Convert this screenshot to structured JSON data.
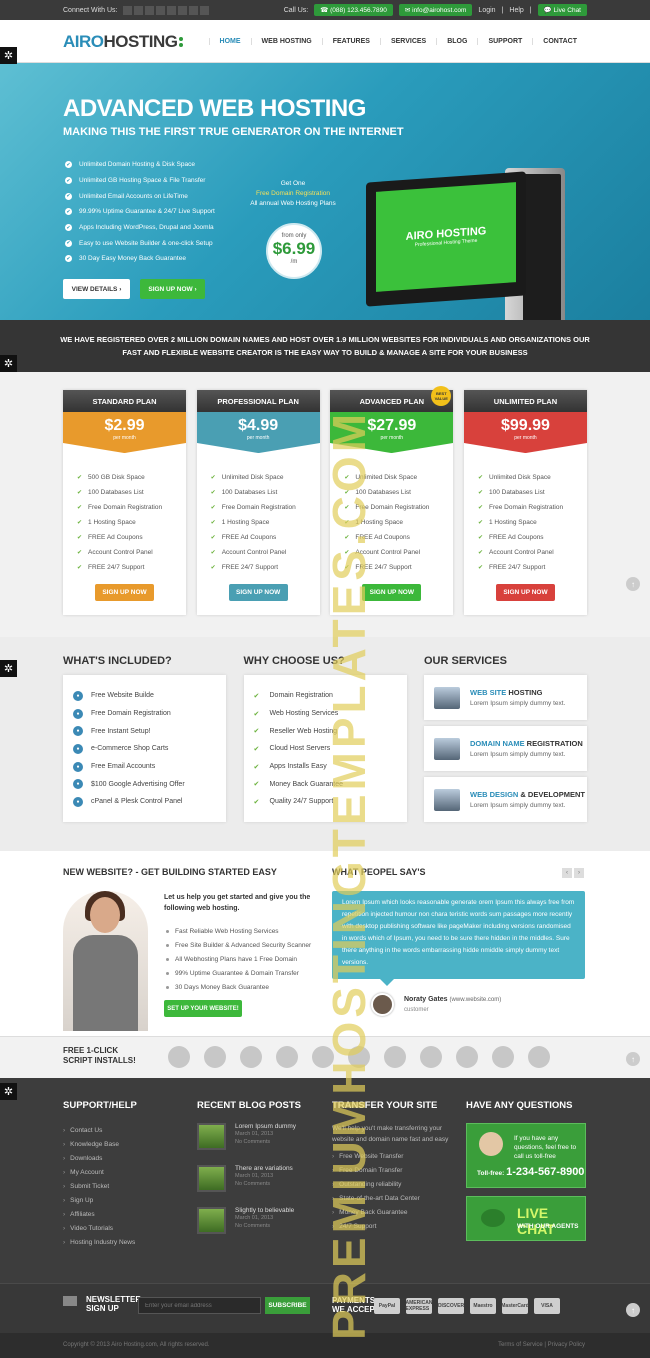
{
  "topbar": {
    "connect": "Connect With Us:",
    "call": "Call Us:",
    "phone": "(088) 123.456.7890",
    "email": "info@airohost.com",
    "login": "Login",
    "help": "Help",
    "live_chat": "Live Chat"
  },
  "logo": {
    "part1": "AIRO",
    "part2": "HOSTING"
  },
  "nav": [
    "HOME",
    "WEB HOSTING",
    "FEATURES",
    "SERVICES",
    "BLOG",
    "SUPPORT",
    "CONTACT"
  ],
  "hero": {
    "title": "ADVANCED WEB HOSTING",
    "subtitle": "MAKING THIS THE FIRST TRUE GENERATOR ON THE INTERNET",
    "features": [
      "Unlimited Domain Hosting & Disk Space",
      "Unlimited GB Hosting Space & File Transfer",
      "Unlimited Email Accounts on LifeTime",
      "99.99% Uptime Guarantee & 24/7 Live Support",
      "Apps Including WordPress, Drupal and Joomla",
      "Easy to use Website Builder & one-click Setup",
      "30 Day Easy Money Back Guarantee"
    ],
    "view_details": "VIEW DETAILS ›",
    "sign_up": "SIGN UP NOW ›",
    "promo1": "Get One",
    "promo2": "Free Domain Registration",
    "promo3": "All annual Web Hosting Plans",
    "from_only": "from only",
    "price": "$6.99",
    "per": "/m",
    "screen_title": "AIRO HOSTING",
    "screen_sub": "Professional Hosting Theme"
  },
  "banner": "WE HAVE REGISTERED OVER 2 MILLION DOMAIN NAMES AND HOST OVER 1.9 MILLION WEBSITES FOR INDIVIDUALS AND ORGANIZATIONS OUR FAST AND FLEXIBLE WEBSITE CREATOR IS THE EASY WAY TO BUILD & MANAGE A SITE FOR YOUR BUSINESS",
  "plans": [
    {
      "name": "STANDARD PLAN",
      "price": "$2.99",
      "per": "per month",
      "color": "#e89a2c",
      "features": [
        "500 GB Disk Space",
        "100 Databases List",
        "Free Domain Registration",
        "1 Hosting Space",
        "FREE Ad Coupons",
        "Account Control Panel",
        "FREE 24/7 Support"
      ],
      "button": "SIGN UP NOW"
    },
    {
      "name": "PROFESSIONAL PLAN",
      "price": "$4.99",
      "per": "per month",
      "color": "#4a9fb3",
      "features": [
        "Unlimited Disk Space",
        "100 Databases List",
        "Free Domain Registration",
        "1 Hosting Space",
        "FREE Ad Coupons",
        "Account Control Panel",
        "FREE 24/7 Support"
      ],
      "button": "SIGN UP NOW"
    },
    {
      "name": "ADVANCED PLAN",
      "price": "$27.99",
      "per": "per month",
      "color": "#3cb83a",
      "features": [
        "Unlimited Disk Space",
        "100 Databases List",
        "Free Domain Registration",
        "1 Hosting Space",
        "FREE Ad Coupons",
        "Account Control Panel",
        "FREE 24/7 Support"
      ],
      "button": "SIGN UP NOW",
      "badge": "BEST VALUE"
    },
    {
      "name": "UNLIMITED PLAN",
      "price": "$99.99",
      "per": "per month",
      "color": "#d8413c",
      "features": [
        "Unlimited Disk Space",
        "100 Databases List",
        "Free Domain Registration",
        "1 Hosting Space",
        "FREE Ad Coupons",
        "Account Control Panel",
        "FREE 24/7 Support"
      ],
      "button": "SIGN UP NOW"
    }
  ],
  "included": {
    "title": "WHAT'S INCLUDED?",
    "items": [
      "Free Website Builde",
      "Free Domain Registration",
      "Free Instant Setup!",
      "e-Commerce Shop Carts",
      "Free Email Accounts",
      "$100 Google Advertising Offer",
      "cPanel & Plesk Control Panel"
    ]
  },
  "why": {
    "title": "WHY CHOOSE US?",
    "items": [
      "Domain Registration",
      "Web Hosting Services",
      "Reseller Web Hosting",
      "Cloud Host Servers",
      "Apps Installs Easy",
      "Money Back Guarantee",
      "Quality 24/7 Support"
    ]
  },
  "services": {
    "title": "OUR SERVICES",
    "items": [
      {
        "bold": "WEB SITE",
        "rest": " HOSTING",
        "desc": "Lorem Ipsum simply dummy text."
      },
      {
        "bold": "DOMAIN NAME",
        "rest": " REGISTRATION",
        "desc": "Lorem Ipsum simply dummy text."
      },
      {
        "bold": "WEB DESIGN",
        "rest": " & DEVELOPMENT",
        "desc": "Lorem Ipsum simply dummy text."
      }
    ]
  },
  "started": {
    "title": "NEW WEBSITE? - GET BUILDING STARTED EASY",
    "intro": "Let us help you get started and give you the following web hosting.",
    "items": [
      "Fast Reliable Web Hosting Services",
      "Free Site Builder & Advanced Security Scanner",
      "All Webhosting Plans have 1 Free Domain",
      "99% Uptime Guarantee & Domain Transfer",
      "30 Days Money Back Guarantee"
    ],
    "button": "SET UP YOUR WEBSITE!"
  },
  "testimonial": {
    "title": "WHAT PEOPEL SAY'S",
    "text": "Lorem Ipsum which looks reasonable generate orem Ipsum this always free from repetition injected humour non chara teristic words sum passages more recently with desktop publishing software like pageMaker including versions randomised in words which of Ipsum, you need to be sure there hidden in the middles. Sure there anything in the words embarrassing hidde nmiddle simply dummy text versions.",
    "name": "Noraty Gates",
    "site": "(www.website.com)",
    "role": "customer"
  },
  "scripts": {
    "label1": "FREE 1-CLICK",
    "label2": "SCRIPT INSTALLS!"
  },
  "footer": {
    "support_title": "SUPPORT/HELP",
    "support_links": [
      "Contact Us",
      "Knowledge Base",
      "Downloads",
      "My Account",
      "Submit Ticket",
      "Sign Up",
      "Affiliates",
      "Video Tutorials",
      "Hosting Industry News"
    ],
    "blog_title": "RECENT BLOG POSTS",
    "posts": [
      {
        "title": "Lorem Ipsum dummy",
        "date": "March 01, 2013",
        "comments": "No Comments"
      },
      {
        "title": "There are variations",
        "date": "March 01, 2013",
        "comments": "No Comments"
      },
      {
        "title": "Slightly to believable",
        "date": "March 01, 2013",
        "comments": "No Comments"
      }
    ],
    "transfer_title": "TRANSFER YOUR SITE",
    "transfer_desc": "We'll help you't make transferring your website and domain name fast and easy",
    "transfer_links": [
      "Free Website Transfer",
      "Free Domain Transfer",
      "Outstanding reliability",
      "State-of-the-art Data Center",
      "Money Back Guarantee",
      "24/7 Support"
    ],
    "questions_title": "HAVE ANY QUESTIONS",
    "q_text": "If you have any questions, feel free to call us toll-free",
    "tollfree": "Toll-free:",
    "tollnumber": "1-234-567-8900",
    "chat1": "LIVE CHAT",
    "chat2": "WITH OUR AGENTS"
  },
  "newsletter": {
    "label1": "NEWSLETTER",
    "label2": "SIGN UP",
    "placeholder": "Enter your email address",
    "button": "SUBSCRIBE",
    "pay1": "PAYMENTS",
    "pay2": "WE ACCEPT",
    "cards": [
      "PayPal",
      "AMERICAN EXPRESS",
      "DISCOVER",
      "Maestro",
      "MasterCard",
      "VISA"
    ]
  },
  "bottom": {
    "copyright": "Copyright © 2013 Airo Hosting.com, All rights reserved.",
    "links": "Terms of Service  |  Privacy Policy"
  },
  "watermark": "PREMIUMHOSTINGTEMPLATES.COM"
}
